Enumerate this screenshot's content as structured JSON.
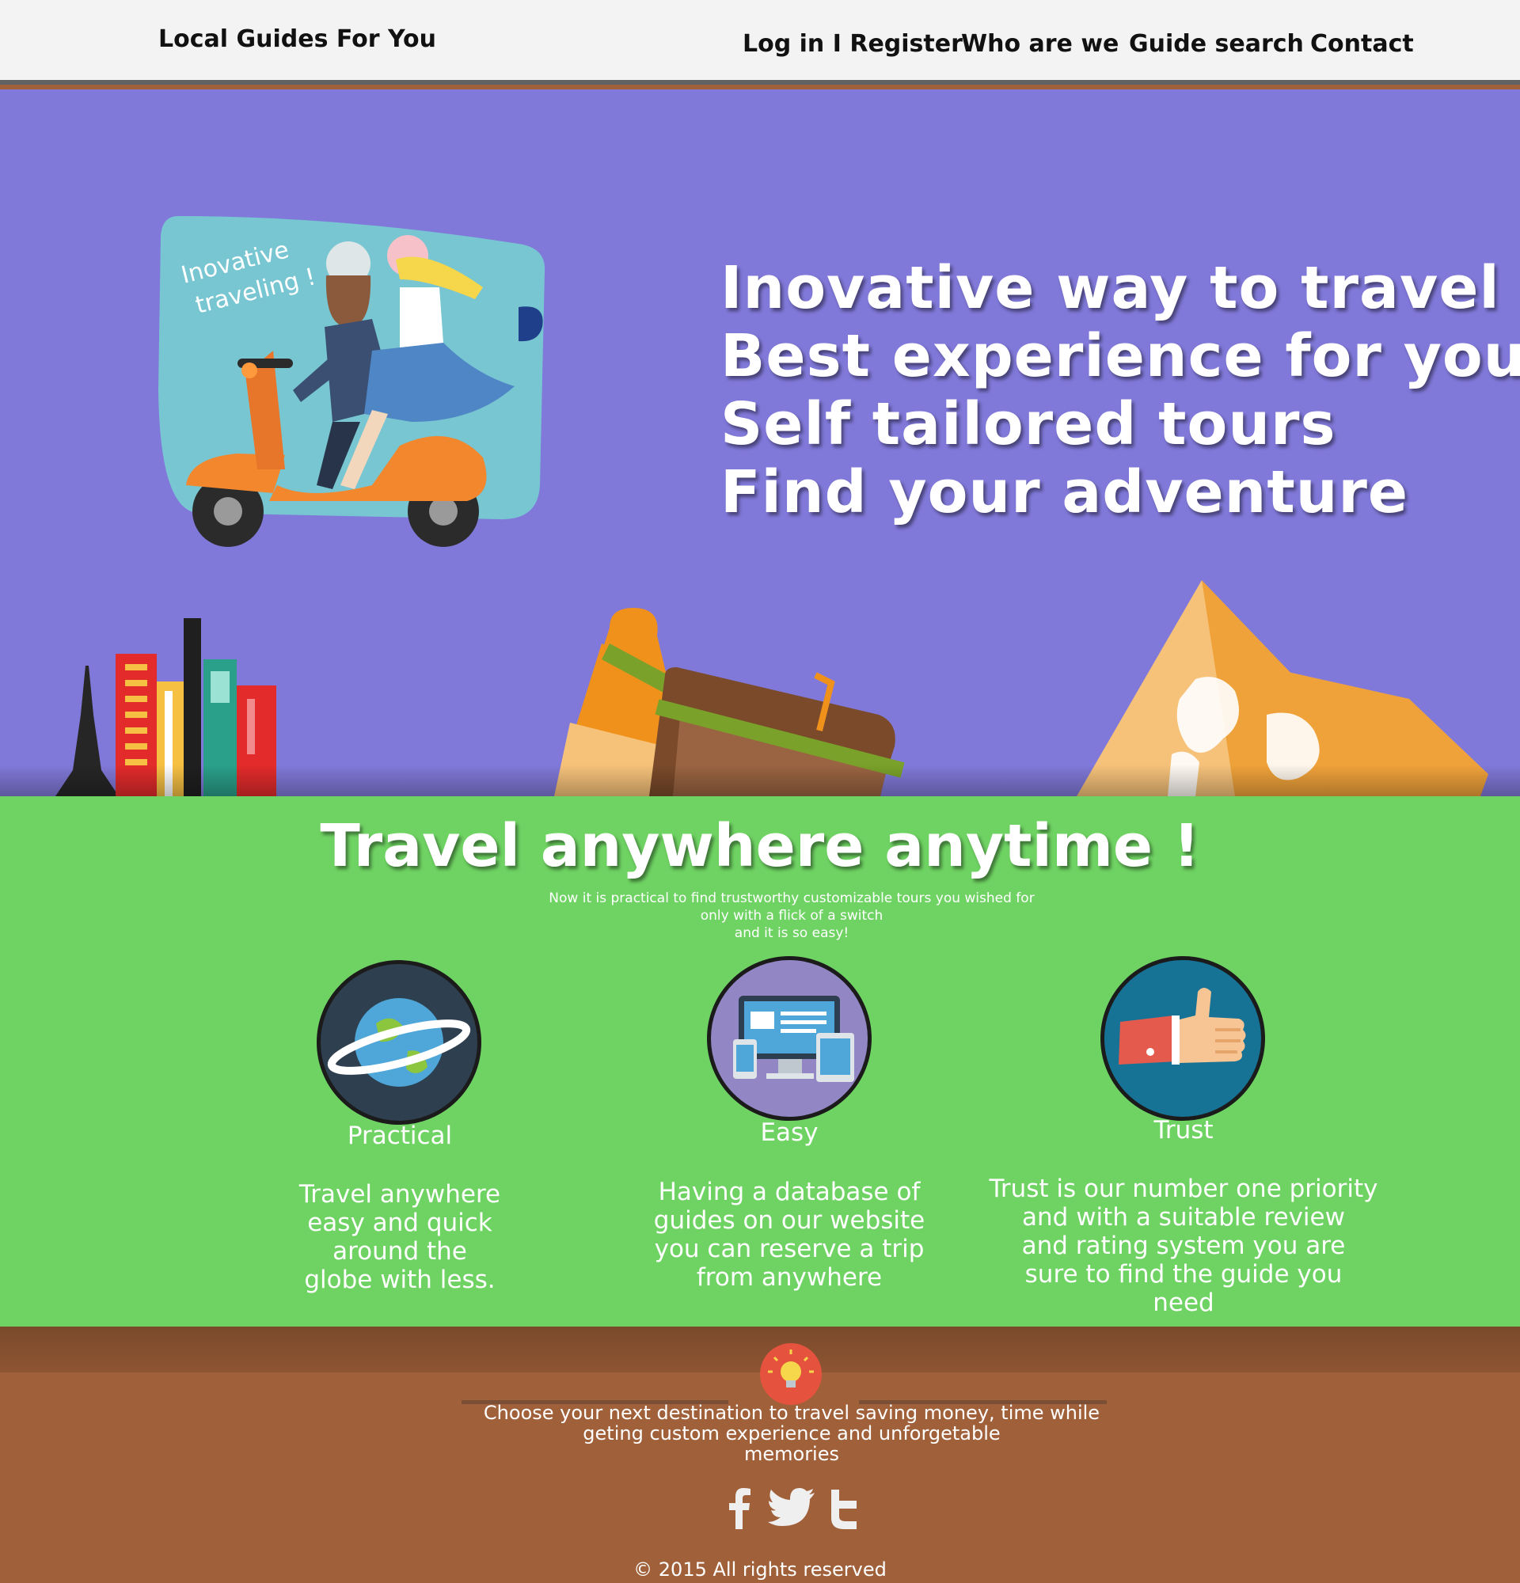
{
  "header": {
    "brand": "Local Guides For You",
    "nav": {
      "login": "Log in I Register",
      "who": "Who are we",
      "guide_search": "Guide search",
      "contact": "Contact"
    }
  },
  "hero": {
    "badge": {
      "line1": "Inovative",
      "line2": "traveling !"
    },
    "lines": [
      "Inovative way to travel",
      "Best experience for you",
      "Self tailored tours",
      "Find your adventure"
    ]
  },
  "features": {
    "title": "Travel anywhere anytime !",
    "subtitle": [
      "Now it is practical to find trustworthy customizable tours you wished for",
      "only with a flick of a switch",
      "and it is so easy!"
    ],
    "items": [
      {
        "name": "Practical",
        "icon": "globe-icon",
        "desc": [
          "Travel anywhere",
          "easy and quick",
          "around the",
          "globe with less."
        ]
      },
      {
        "name": "Easy",
        "icon": "devices-icon",
        "desc": [
          "Having a database of",
          "guides on our website",
          "you can reserve a trip",
          "from anywhere"
        ]
      },
      {
        "name": "Trust",
        "icon": "thumbs-up-icon",
        "desc": [
          "Trust is our number one priority",
          "and with a suitable review",
          "and rating system you are",
          "sure to find the guide you",
          "need"
        ]
      }
    ]
  },
  "footer": {
    "text": [
      "Choose your next destination to travel saving money, time while",
      "geting custom experience and unforgetable",
      "memories"
    ],
    "social": [
      "facebook-icon",
      "twitter-icon",
      "tumblr-icon"
    ],
    "copyright": "© 2015 All rights reserved"
  },
  "colors": {
    "hero_bg": "#8079d9",
    "features_bg": "#6fd363",
    "footer_bg": "#a0613a",
    "header_bg": "#f3f3f3"
  }
}
